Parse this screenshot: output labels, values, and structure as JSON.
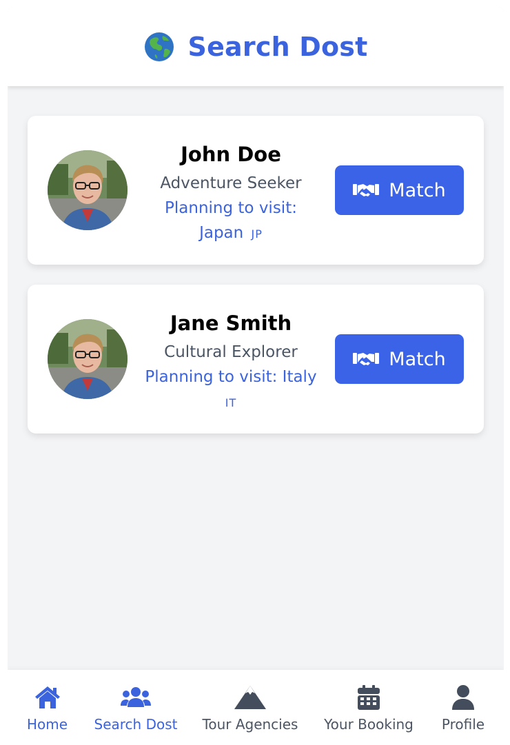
{
  "header": {
    "icon": "globe-icon",
    "title": "Search Dost",
    "accent_color": "#3b63dd"
  },
  "cards": [
    {
      "name": "John Doe",
      "role": "Adventure Seeker",
      "plan": "Planning to visit: Japan",
      "flag": "JP",
      "button_label": "Match",
      "button_icon": "handshake-icon"
    },
    {
      "name": "Jane Smith",
      "role": "Cultural Explorer",
      "plan": "Planning to visit: Italy",
      "flag": "IT",
      "button_label": "Match",
      "button_icon": "handshake-icon"
    }
  ],
  "nav": {
    "active": "Search Dost",
    "items": [
      {
        "label": "Home",
        "icon": "home-icon"
      },
      {
        "label": "Search Dost",
        "icon": "users-icon"
      },
      {
        "label": "Tour Agencies",
        "icon": "mountain-icon"
      },
      {
        "label": "Your Booking",
        "icon": "calendar-icon"
      },
      {
        "label": "Profile",
        "icon": "user-icon"
      }
    ]
  }
}
